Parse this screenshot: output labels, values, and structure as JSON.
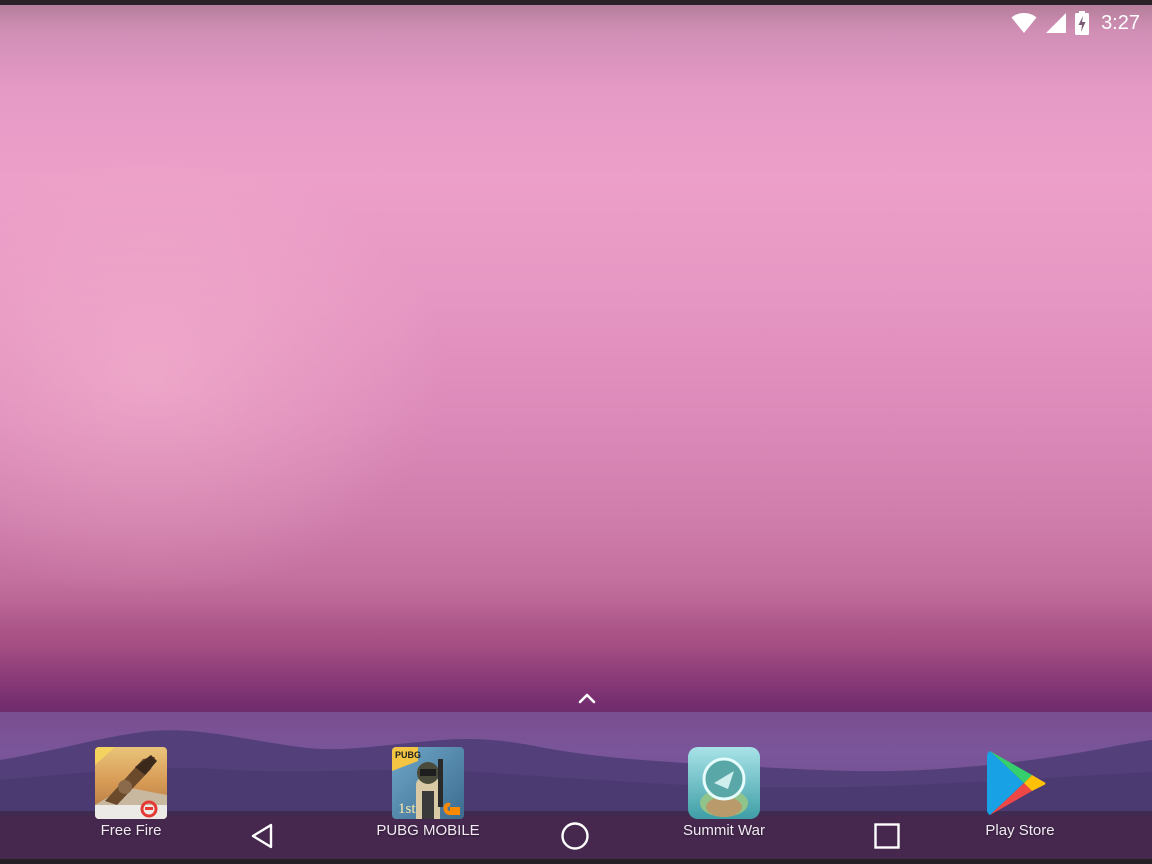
{
  "status_bar": {
    "time": "3:27",
    "icons": [
      "wifi-icon",
      "cell-signal-icon",
      "battery-charging-icon"
    ]
  },
  "home": {
    "all_apps_icon": "chevron-up-icon"
  },
  "dock": {
    "apps": [
      {
        "label": "Free Fire",
        "icon": "free-fire-icon"
      },
      {
        "label": "PUBG MOBILE",
        "icon": "pubg-mobile-icon",
        "icon_badge": "PUBG",
        "icon_text": "1st"
      },
      {
        "label": "Summit War",
        "icon": "summit-war-icon"
      },
      {
        "label": "Play Store",
        "icon": "play-store-icon"
      }
    ]
  },
  "nav_bar": {
    "buttons": [
      "back-icon",
      "home-icon",
      "recents-icon"
    ]
  },
  "colors": {
    "sky_top": "#d08eb5",
    "sky_mid": "#ec9fc8",
    "horizon": "#8a3c78",
    "lake": "#7a559a",
    "mountains": "#4f3a6e",
    "nav_bar": "#37264a"
  }
}
